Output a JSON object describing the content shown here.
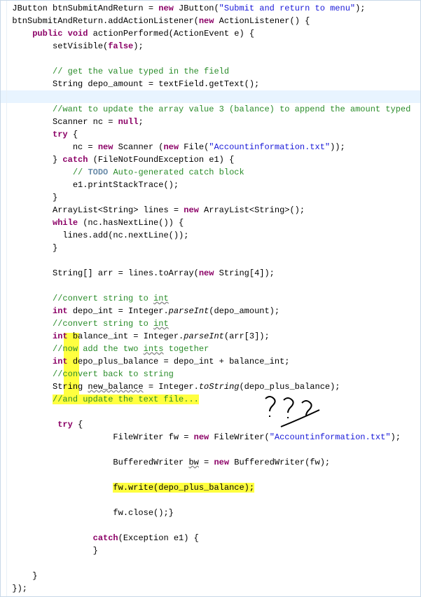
{
  "lines": [
    {
      "kind": "code",
      "segs": [
        {
          "t": "  ",
          "c": ""
        },
        {
          "t": "JButton btnSubmitAndReturn = ",
          "c": "type"
        },
        {
          "t": "new",
          "c": "kw"
        },
        {
          "t": " JButton(",
          "c": ""
        },
        {
          "t": "\"Submit and return to menu\"",
          "c": "str"
        },
        {
          "t": ");",
          "c": ""
        }
      ]
    },
    {
      "kind": "code",
      "segs": [
        {
          "t": "  btnSubmitAndReturn.addActionListener(",
          "c": ""
        },
        {
          "t": "new",
          "c": "kw"
        },
        {
          "t": " ActionListener() {",
          "c": ""
        }
      ]
    },
    {
      "kind": "code",
      "segs": [
        {
          "t": "      ",
          "c": ""
        },
        {
          "t": "public void",
          "c": "kw"
        },
        {
          "t": " actionPerformed(ActionEvent e) {",
          "c": ""
        }
      ]
    },
    {
      "kind": "code",
      "segs": [
        {
          "t": "          setVisible(",
          "c": ""
        },
        {
          "t": "false",
          "c": "kw"
        },
        {
          "t": ");",
          "c": ""
        }
      ]
    },
    {
      "kind": "blank",
      "segs": [
        {
          "t": " ",
          "c": ""
        }
      ]
    },
    {
      "kind": "code",
      "segs": [
        {
          "t": "          ",
          "c": ""
        },
        {
          "t": "// get the value typed in the field",
          "c": "cmt"
        }
      ]
    },
    {
      "kind": "code",
      "segs": [
        {
          "t": "          String depo_amount = textField.getText();",
          "c": ""
        }
      ]
    },
    {
      "kind": "highlighted",
      "segs": [
        {
          "t": "          ",
          "c": ""
        }
      ]
    },
    {
      "kind": "code",
      "segs": [
        {
          "t": "          ",
          "c": ""
        },
        {
          "t": "//want to update the array value 3 (balance) to append the amount typed",
          "c": "cmt"
        }
      ]
    },
    {
      "kind": "code",
      "segs": [
        {
          "t": "          Scanner nc = ",
          "c": ""
        },
        {
          "t": "null",
          "c": "kw"
        },
        {
          "t": ";",
          "c": ""
        }
      ]
    },
    {
      "kind": "code",
      "segs": [
        {
          "t": "          ",
          "c": ""
        },
        {
          "t": "try",
          "c": "kw"
        },
        {
          "t": " {",
          "c": ""
        }
      ]
    },
    {
      "kind": "code",
      "segs": [
        {
          "t": "              nc = ",
          "c": ""
        },
        {
          "t": "new",
          "c": "kw"
        },
        {
          "t": " Scanner (",
          "c": ""
        },
        {
          "t": "new",
          "c": "kw"
        },
        {
          "t": " File(",
          "c": ""
        },
        {
          "t": "\"Accountinformation.txt\"",
          "c": "str"
        },
        {
          "t": "));",
          "c": ""
        }
      ]
    },
    {
      "kind": "code",
      "segs": [
        {
          "t": "          } ",
          "c": ""
        },
        {
          "t": "catch",
          "c": "kw"
        },
        {
          "t": " (FileNotFoundException e1) {",
          "c": ""
        }
      ]
    },
    {
      "kind": "code",
      "segs": [
        {
          "t": "              ",
          "c": ""
        },
        {
          "t": "// ",
          "c": "cmt"
        },
        {
          "t": "TODO",
          "c": "todo"
        },
        {
          "t": " Auto-generated catch block",
          "c": "cmt"
        }
      ]
    },
    {
      "kind": "code",
      "segs": [
        {
          "t": "              e1.printStackTrace();",
          "c": ""
        }
      ]
    },
    {
      "kind": "code",
      "segs": [
        {
          "t": "          }",
          "c": ""
        }
      ]
    },
    {
      "kind": "code",
      "segs": [
        {
          "t": "          ArrayList<String> lines = ",
          "c": ""
        },
        {
          "t": "new",
          "c": "kw"
        },
        {
          "t": " ArrayList<String>();",
          "c": ""
        }
      ]
    },
    {
      "kind": "code",
      "segs": [
        {
          "t": "          ",
          "c": ""
        },
        {
          "t": "while",
          "c": "kw"
        },
        {
          "t": " (nc.hasNextLine()) {",
          "c": ""
        }
      ]
    },
    {
      "kind": "code",
      "segs": [
        {
          "t": "            lines.add(nc.nextLine());",
          "c": ""
        }
      ]
    },
    {
      "kind": "code",
      "segs": [
        {
          "t": "          }",
          "c": ""
        }
      ]
    },
    {
      "kind": "blank",
      "segs": [
        {
          "t": " ",
          "c": ""
        }
      ]
    },
    {
      "kind": "code",
      "segs": [
        {
          "t": "          String[] arr = lines.toArray(",
          "c": ""
        },
        {
          "t": "new",
          "c": "kw"
        },
        {
          "t": " String[4]);",
          "c": ""
        }
      ]
    },
    {
      "kind": "blank",
      "segs": [
        {
          "t": " ",
          "c": ""
        }
      ]
    },
    {
      "kind": "code",
      "segs": [
        {
          "t": "          ",
          "c": ""
        },
        {
          "t": "//convert string to ",
          "c": "cmt"
        },
        {
          "t": "int",
          "c": "cmt",
          "u": true
        }
      ]
    },
    {
      "kind": "code",
      "segs": [
        {
          "t": "          ",
          "c": ""
        },
        {
          "t": "int",
          "c": "kw"
        },
        {
          "t": " depo_int = Integer.",
          "c": ""
        },
        {
          "t": "parseInt",
          "c": "itl"
        },
        {
          "t": "(depo_amount);",
          "c": ""
        }
      ]
    },
    {
      "kind": "code",
      "segs": [
        {
          "t": "          ",
          "c": ""
        },
        {
          "t": "//convert string to ",
          "c": "cmt"
        },
        {
          "t": "int",
          "c": "cmt",
          "u": true
        }
      ]
    },
    {
      "kind": "code",
      "segs": [
        {
          "t": "          ",
          "c": ""
        },
        {
          "t": "int",
          "c": "kw"
        },
        {
          "t": " balance_int = Integer.",
          "c": ""
        },
        {
          "t": "parseInt",
          "c": "itl"
        },
        {
          "t": "(arr[3]);",
          "c": ""
        }
      ]
    },
    {
      "kind": "code",
      "segs": [
        {
          "t": "          ",
          "c": ""
        },
        {
          "t": "//now add the two ",
          "c": "cmt"
        },
        {
          "t": "ints",
          "c": "cmt",
          "u": true
        },
        {
          "t": " together",
          "c": "cmt"
        }
      ]
    },
    {
      "kind": "code",
      "segs": [
        {
          "t": "          ",
          "c": ""
        },
        {
          "t": "int",
          "c": "kw"
        },
        {
          "t": " depo_plus_balance = depo_int + balance_int;",
          "c": ""
        }
      ]
    },
    {
      "kind": "code",
      "segs": [
        {
          "t": "          ",
          "c": ""
        },
        {
          "t": "//convert back to string",
          "c": "cmt"
        }
      ]
    },
    {
      "kind": "code",
      "segs": [
        {
          "t": "          String ",
          "c": ""
        },
        {
          "t": "new_balance",
          "c": "",
          "u": true
        },
        {
          "t": " = Integer.",
          "c": ""
        },
        {
          "t": "toString",
          "c": "itl"
        },
        {
          "t": "(depo_plus_balance);",
          "c": ""
        }
      ]
    },
    {
      "kind": "code",
      "segs": [
        {
          "t": "          ",
          "c": ""
        },
        {
          "t": "//and update the text file...",
          "c": "cmt",
          "hl": "y"
        }
      ]
    },
    {
      "kind": "blank",
      "segs": [
        {
          "t": " ",
          "c": ""
        }
      ]
    },
    {
      "kind": "code",
      "segs": [
        {
          "t": "           ",
          "c": ""
        },
        {
          "t": "try",
          "c": "kw"
        },
        {
          "t": " {",
          "c": ""
        }
      ]
    },
    {
      "kind": "code",
      "segs": [
        {
          "t": "                      FileWriter fw = ",
          "c": ""
        },
        {
          "t": "new",
          "c": "kw"
        },
        {
          "t": " FileWriter(",
          "c": ""
        },
        {
          "t": "\"Accountinformation.txt\"",
          "c": "str"
        },
        {
          "t": ");",
          "c": ""
        }
      ]
    },
    {
      "kind": "blank",
      "segs": [
        {
          "t": " ",
          "c": ""
        }
      ]
    },
    {
      "kind": "code",
      "segs": [
        {
          "t": "                      BufferedWriter ",
          "c": ""
        },
        {
          "t": "bw",
          "c": "",
          "u": true
        },
        {
          "t": " = ",
          "c": ""
        },
        {
          "t": "new",
          "c": "kw"
        },
        {
          "t": " BufferedWriter(fw);",
          "c": ""
        }
      ]
    },
    {
      "kind": "blank",
      "segs": [
        {
          "t": " ",
          "c": ""
        }
      ]
    },
    {
      "kind": "code",
      "segs": [
        {
          "t": "                      ",
          "c": ""
        },
        {
          "t": "fw.write(depo_plus_balance);",
          "c": "",
          "hl": "y"
        }
      ]
    },
    {
      "kind": "blank",
      "segs": [
        {
          "t": " ",
          "c": ""
        }
      ]
    },
    {
      "kind": "code",
      "segs": [
        {
          "t": "                      fw.close();}",
          "c": ""
        }
      ]
    },
    {
      "kind": "blank",
      "segs": [
        {
          "t": " ",
          "c": ""
        }
      ]
    },
    {
      "kind": "code",
      "segs": [
        {
          "t": "                  ",
          "c": ""
        },
        {
          "t": "catch",
          "c": "kw"
        },
        {
          "t": "(Exception e1) {",
          "c": ""
        }
      ]
    },
    {
      "kind": "code",
      "segs": [
        {
          "t": "                  }",
          "c": ""
        }
      ]
    },
    {
      "kind": "blank",
      "segs": [
        {
          "t": " ",
          "c": ""
        }
      ]
    },
    {
      "kind": "code",
      "segs": [
        {
          "t": "      }",
          "c": ""
        }
      ]
    },
    {
      "kind": "code",
      "segs": [
        {
          "t": "  });",
          "c": ""
        }
      ]
    }
  ],
  "annotation_text": "???"
}
